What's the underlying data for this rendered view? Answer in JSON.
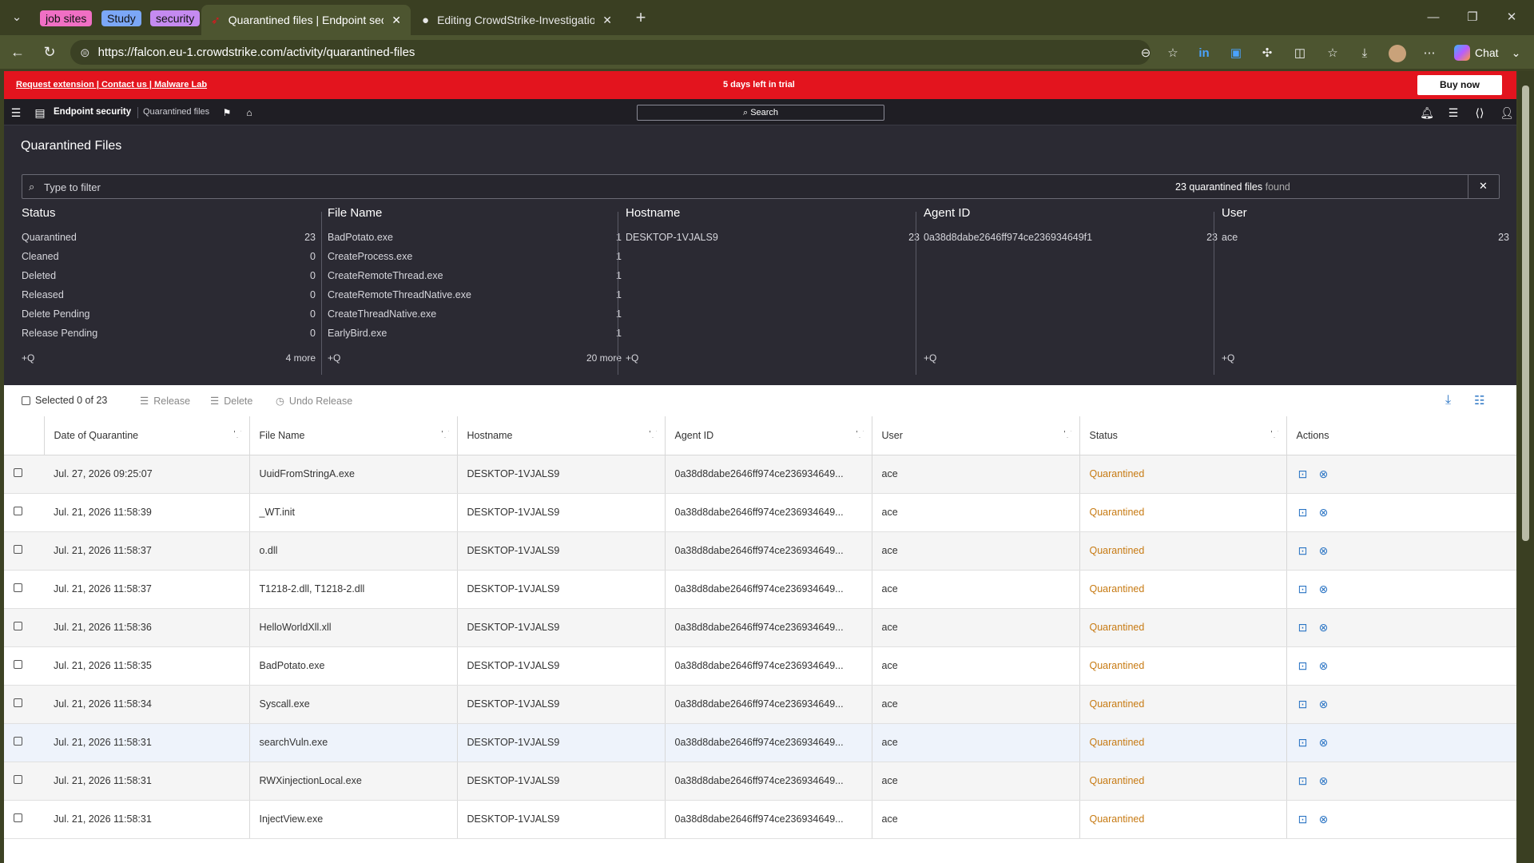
{
  "browser": {
    "tab_groups": [
      {
        "label": "job sites",
        "color": "#f06fc4"
      },
      {
        "label": "Study",
        "color": "#7ba7f7"
      },
      {
        "label": "security",
        "color": "#c58af0"
      }
    ],
    "tabs": [
      {
        "title": "Quarantined files | Endpoint security"
      },
      {
        "title": "Editing CrowdStrike-Investigations"
      }
    ],
    "url": "https://falcon.eu-1.crowdstrike.com/activity/quarantined-files",
    "chat_label": "Chat"
  },
  "trial_banner": {
    "links": "Request extension | Contact us | Malware Lab",
    "message": "5 days left in trial",
    "buy_label": "Buy now"
  },
  "appbar": {
    "product": "Endpoint security",
    "page": "Quarantined files",
    "search_label": "Search"
  },
  "page_title": "Quarantined Files",
  "filter": {
    "placeholder": "Type to filter",
    "count_prefix": "23 quarantined files",
    "count_suffix": "found"
  },
  "facets": [
    {
      "title": "Status",
      "rows": [
        {
          "label": "Quarantined",
          "count": "23"
        },
        {
          "label": "Cleaned",
          "count": "0"
        },
        {
          "label": "Deleted",
          "count": "0"
        },
        {
          "label": "Released",
          "count": "0"
        },
        {
          "label": "Delete Pending",
          "count": "0"
        },
        {
          "label": "Release Pending",
          "count": "0"
        }
      ],
      "add": "+Q",
      "more": "4 more"
    },
    {
      "title": "File Name",
      "rows": [
        {
          "label": "BadPotato.exe",
          "count": "1"
        },
        {
          "label": "CreateProcess.exe",
          "count": "1"
        },
        {
          "label": "CreateRemoteThread.exe",
          "count": "1"
        },
        {
          "label": "CreateRemoteThreadNative.exe",
          "count": "1"
        },
        {
          "label": "CreateThreadNative.exe",
          "count": "1"
        },
        {
          "label": "EarlyBird.exe",
          "count": "1"
        }
      ],
      "add": "+Q",
      "more": "20 more"
    },
    {
      "title": "Hostname",
      "rows": [
        {
          "label": "DESKTOP-1VJALS9",
          "count": "23"
        }
      ],
      "add": "+Q",
      "more": ""
    },
    {
      "title": "Agent ID",
      "rows": [
        {
          "label": "0a38d8dabe2646ff974ce236934649f1",
          "count": "23"
        }
      ],
      "add": "+Q",
      "more": ""
    },
    {
      "title": "User",
      "rows": [
        {
          "label": "ace",
          "count": "23"
        }
      ],
      "add": "+Q",
      "more": ""
    }
  ],
  "bulk_actions": {
    "selected": "Selected 0 of 23",
    "release": "Release",
    "delete": "Delete",
    "undo": "Undo Release"
  },
  "table": {
    "headers": [
      "Date of Quarantine",
      "File Name",
      "Hostname",
      "Agent ID",
      "User",
      "Status",
      "Actions"
    ],
    "rows": [
      {
        "date": "Jul. 27, 2026 09:25:07",
        "file": "UuidFromStringA.exe",
        "host": "DESKTOP-1VJALS9",
        "agent": "0a38d8dabe2646ff974ce236934649...",
        "user": "ace",
        "status": "Quarantined"
      },
      {
        "date": "Jul. 21, 2026 11:58:39",
        "file": "_WT.init",
        "host": "DESKTOP-1VJALS9",
        "agent": "0a38d8dabe2646ff974ce236934649...",
        "user": "ace",
        "status": "Quarantined"
      },
      {
        "date": "Jul. 21, 2026 11:58:37",
        "file": "o.dll",
        "host": "DESKTOP-1VJALS9",
        "agent": "0a38d8dabe2646ff974ce236934649...",
        "user": "ace",
        "status": "Quarantined"
      },
      {
        "date": "Jul. 21, 2026 11:58:37",
        "file": "T1218-2.dll, T1218-2.dll",
        "host": "DESKTOP-1VJALS9",
        "agent": "0a38d8dabe2646ff974ce236934649...",
        "user": "ace",
        "status": "Quarantined"
      },
      {
        "date": "Jul. 21, 2026 11:58:36",
        "file": "HelloWorldXll.xll",
        "host": "DESKTOP-1VJALS9",
        "agent": "0a38d8dabe2646ff974ce236934649...",
        "user": "ace",
        "status": "Quarantined"
      },
      {
        "date": "Jul. 21, 2026 11:58:35",
        "file": "BadPotato.exe",
        "host": "DESKTOP-1VJALS9",
        "agent": "0a38d8dabe2646ff974ce236934649...",
        "user": "ace",
        "status": "Quarantined"
      },
      {
        "date": "Jul. 21, 2026 11:58:34",
        "file": "Syscall.exe",
        "host": "DESKTOP-1VJALS9",
        "agent": "0a38d8dabe2646ff974ce236934649...",
        "user": "ace",
        "status": "Quarantined"
      },
      {
        "date": "Jul. 21, 2026 11:58:31",
        "file": "searchVuln.exe",
        "host": "DESKTOP-1VJALS9",
        "agent": "0a38d8dabe2646ff974ce236934649...",
        "user": "ace",
        "status": "Quarantined"
      },
      {
        "date": "Jul. 21, 2026 11:58:31",
        "file": "RWXinjectionLocal.exe",
        "host": "DESKTOP-1VJALS9",
        "agent": "0a38d8dabe2646ff974ce236934649...",
        "user": "ace",
        "status": "Quarantined"
      },
      {
        "date": "Jul. 21, 2026 11:58:31",
        "file": "InjectView.exe",
        "host": "DESKTOP-1VJALS9",
        "agent": "0a38d8dabe2646ff974ce236934649...",
        "user": "ace",
        "status": "Quarantined"
      }
    ]
  },
  "colors": {
    "banner_red": "#e3141e",
    "status_orange": "#c77a12",
    "action_blue": "#2a74c4",
    "panel_dark": "#2b2a33"
  }
}
